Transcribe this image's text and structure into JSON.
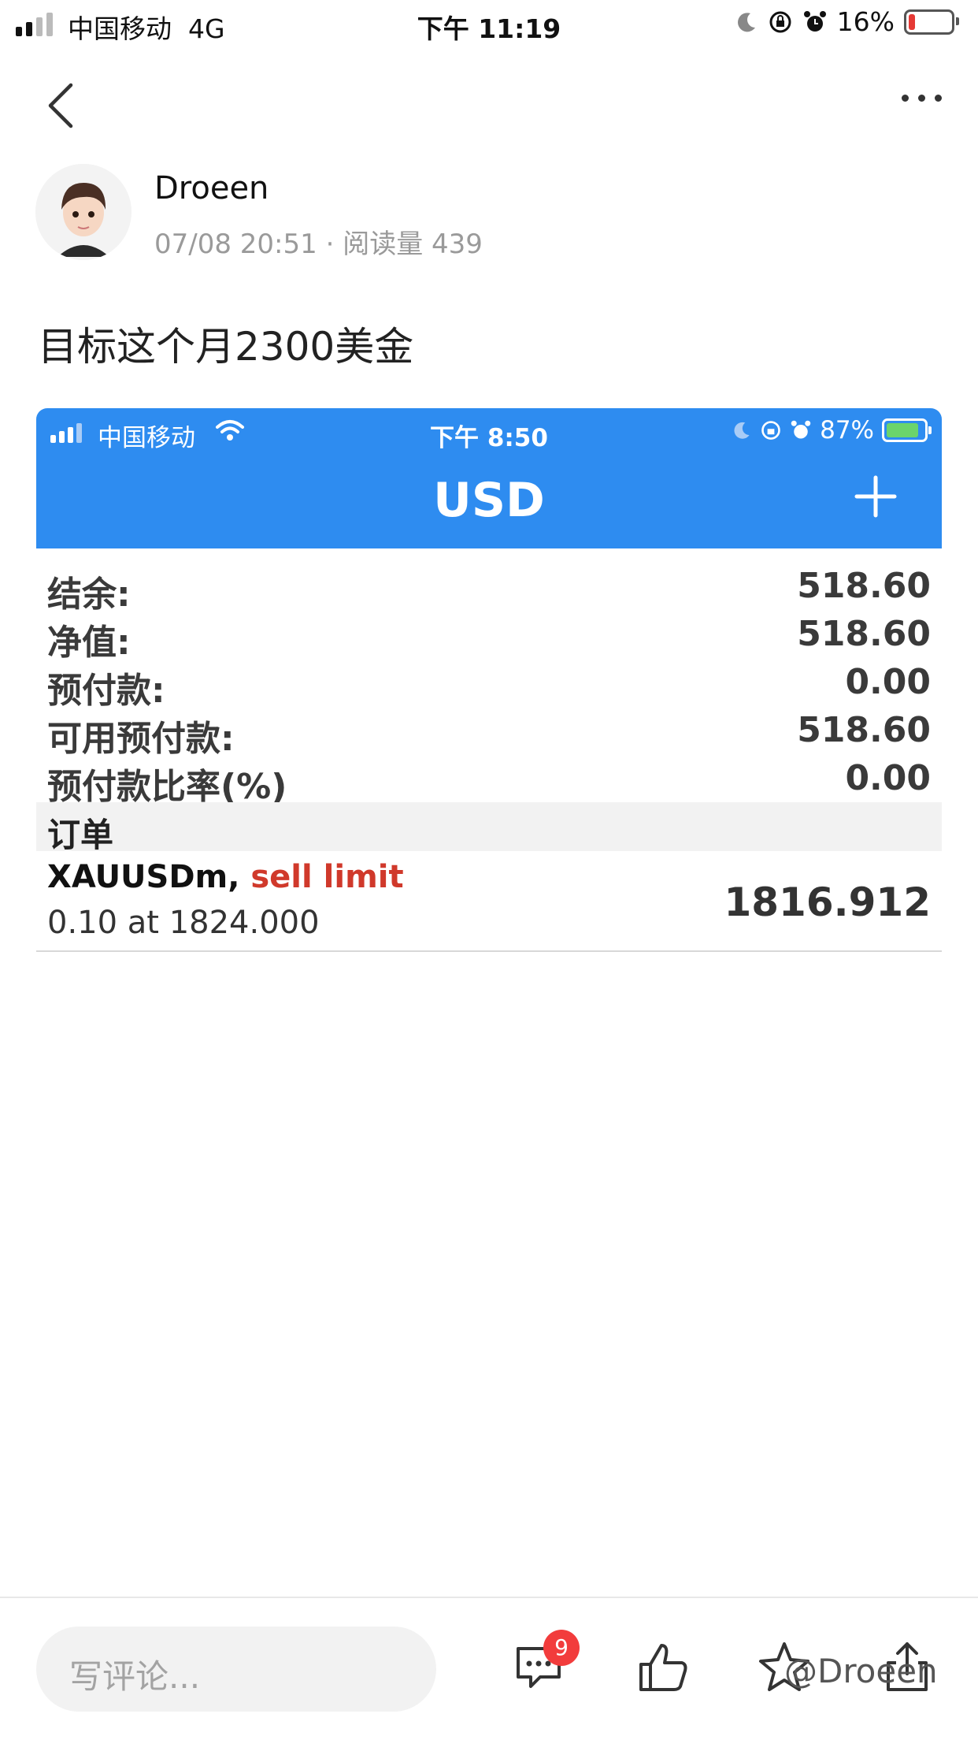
{
  "status_bar": {
    "carrier": "中国移动",
    "network": "4G",
    "time": "下午 11:19",
    "battery": "16%",
    "battery_level": 0.16
  },
  "author": {
    "name": "Droeen",
    "date": "07/08 20:51",
    "separator": "·",
    "reads": "阅读量 439"
  },
  "post": {
    "text": "目标这个月2300美金"
  },
  "embedded": {
    "status_bar": {
      "carrier": "中国移动",
      "time": "下午 8:50",
      "battery": "87%",
      "battery_level": 0.87
    },
    "title": "USD",
    "account": [
      {
        "label": "结余:",
        "value": "518.60"
      },
      {
        "label": "净值:",
        "value": "518.60"
      },
      {
        "label": "预付款:",
        "value": "0.00"
      },
      {
        "label": "可用预付款:",
        "value": "518.60"
      },
      {
        "label": "预付款比率(%)",
        "value": "0.00"
      }
    ],
    "orders_header": "订单",
    "order": {
      "symbol": "XAUUSDm,",
      "type": "sell limit",
      "detail": "0.10 at 1824.000",
      "price": "1816.912"
    }
  },
  "bottom_bar": {
    "comment_placeholder": "写评论...",
    "comment_count": "9",
    "watermark": "@Droeen"
  },
  "colors": {
    "header_blue": "#2e8cf0",
    "sell_red": "#d0392b",
    "badge_red": "#f23c3c"
  }
}
